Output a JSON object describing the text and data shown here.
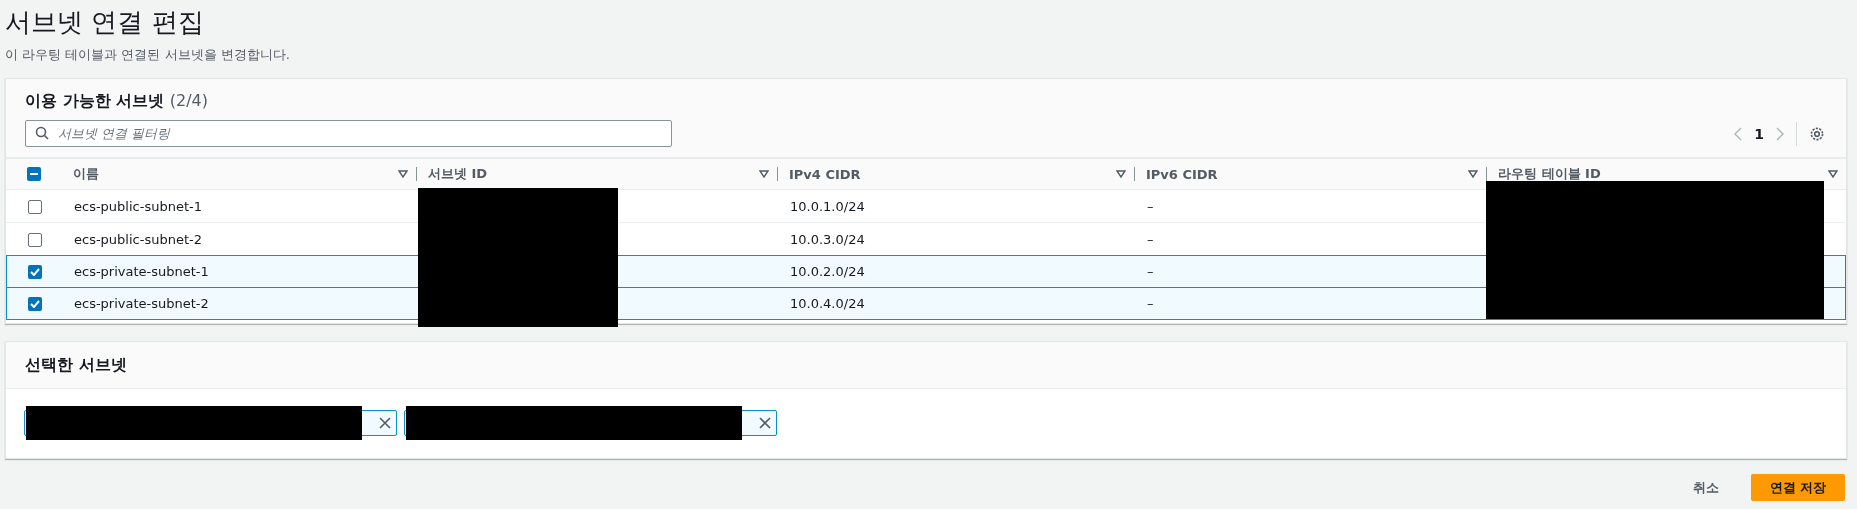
{
  "page": {
    "title": "서브넷 연결 편집",
    "description": "이 라우팅 테이블과 연결된 서브넷을 변경합니다."
  },
  "available": {
    "title": "이용 가능한 서브넷",
    "count": "(2/4)",
    "filter": {
      "placeholder": "서브넷 연결 필터링"
    },
    "page": "1",
    "select_all": {
      "indeterminate": true
    },
    "columns": [
      {
        "label": "이름",
        "redacted": false
      },
      {
        "label": "서브넷 ID",
        "redacted": true
      },
      {
        "label": "IPv4 CIDR",
        "redacted": false
      },
      {
        "label": "IPv6 CIDR",
        "redacted": false
      },
      {
        "label": "라우팅 테이블 ID",
        "redacted": true
      }
    ],
    "rows": [
      {
        "selected": false,
        "name": "ecs-public-subnet-1",
        "ipv4": "10.0.1.0/24",
        "ipv6": "–"
      },
      {
        "selected": false,
        "name": "ecs-public-subnet-2",
        "ipv4": "10.0.3.0/24",
        "ipv6": "–"
      },
      {
        "selected": true,
        "name": "ecs-private-subnet-1",
        "ipv4": "10.0.2.0/24",
        "ipv6": "–"
      },
      {
        "selected": true,
        "name": "ecs-private-subnet-2",
        "ipv4": "10.0.4.0/24",
        "ipv6": "–"
      }
    ]
  },
  "selected_panel": {
    "title": "선택한 서브넷",
    "tokens": [
      {
        "redacted": true
      },
      {
        "redacted": true
      }
    ]
  },
  "footer": {
    "cancel": "취소",
    "save": "연결 저장"
  }
}
